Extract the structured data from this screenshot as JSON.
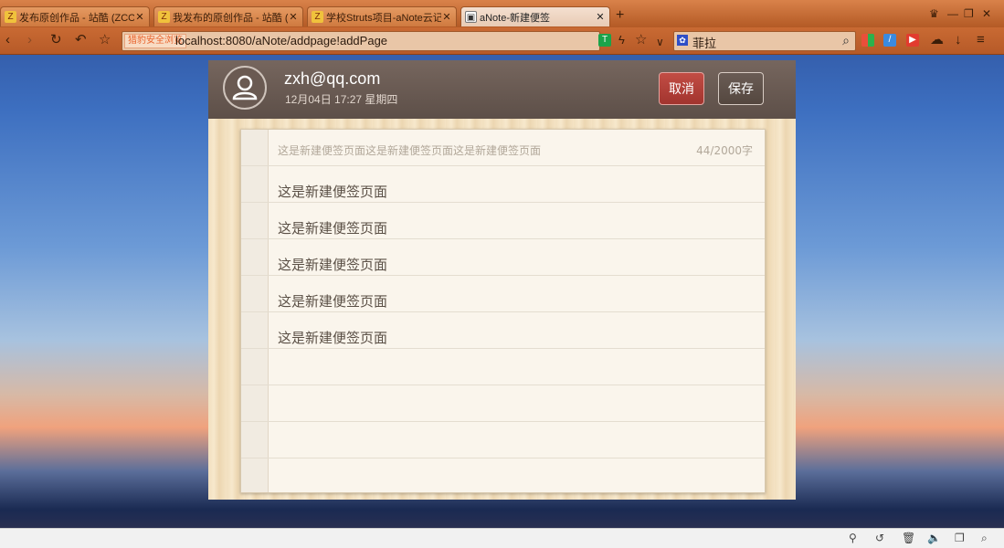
{
  "browser": {
    "tabs": [
      {
        "title": "发布原创作品 - 站酷 (ZCOOL",
        "active": false
      },
      {
        "title": "我发布的原创作品 - 站酷 (ZC",
        "active": false
      },
      {
        "title": "学校Struts项目-aNote云记事",
        "active": false
      },
      {
        "title": "aNote-新建便签",
        "active": true
      }
    ],
    "new_tab_label": "+",
    "address": {
      "badge": "猎豹安全浏览",
      "url": "localhost:8080/aNote/addpage!addPage"
    },
    "search": {
      "engine_icon": "paw-icon",
      "query": "菲拉"
    }
  },
  "app": {
    "user_email": "zxh@qq.com",
    "datetime": "12月04日 17:27 星期四",
    "cancel_label": "取消",
    "save_label": "保存",
    "note": {
      "preview": "这是新建便签页面这是新建便签页面这是新建便签页面",
      "char_count": "44/2000字",
      "lines": [
        "这是新建便签页面",
        "这是新建便签页面",
        "这是新建便签页面",
        "这是新建便签页面",
        "这是新建便签页面"
      ]
    }
  },
  "colors": {
    "cancel_button": "#b03d36",
    "header_bg": "#6b5b53",
    "tabbar": "#c96a33"
  }
}
